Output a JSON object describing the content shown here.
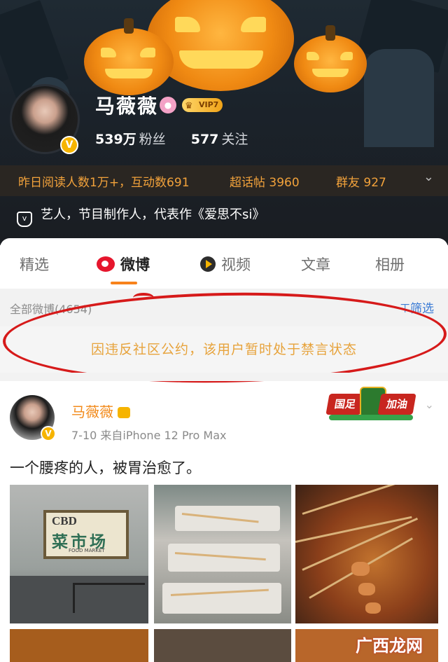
{
  "profile": {
    "name": "马薇薇",
    "vip_label": "VIP7",
    "verified_mark": "V",
    "followers_count": "539万",
    "followers_label": "粉丝",
    "following_count": "577",
    "following_label": "关注",
    "reads_label": "昨日阅读人数1万+，互动数691",
    "supertopic_label": "超话帖 3960",
    "group_label": "群友 927",
    "intro": "艺人，节目制作人，代表作《爱思不si》"
  },
  "tabs": [
    {
      "label": "精选",
      "active": false
    },
    {
      "label": "微博",
      "active": true
    },
    {
      "label": "视频",
      "active": false
    },
    {
      "label": "文章",
      "active": false
    },
    {
      "label": "相册",
      "active": false
    }
  ],
  "filter": {
    "all_label": "全部微博(4654)",
    "filter_label": "筛选"
  },
  "banned_notice": "因违反社区公约，该用户暂时处于禁言状态",
  "post": {
    "author": "马薇薇",
    "meta": "7-10  来自iPhone 12 Pro Max",
    "text": "一个腰疼的人，被胃治愈了。",
    "badge_left": "国足",
    "badge_right": "加油"
  },
  "images": {
    "sign_latin": "CBD",
    "sign_cn": "菜市场",
    "sign_en": "FOOD  MARKET"
  },
  "watermark": "广西龙网",
  "colors": {
    "accent_orange": "#f7821b",
    "banned_text": "#e7a33c",
    "read_bar_text": "#f2a23b",
    "link_blue": "#3a7bd5",
    "highlight_red": "#d61a1a"
  },
  "icons": [
    "pink-badge-icon",
    "vip-crown-icon",
    "verified-icon",
    "chevron-down-icon",
    "shield-icon",
    "weibo-icon",
    "video-icon",
    "filter-icon",
    "crown-icon"
  ]
}
